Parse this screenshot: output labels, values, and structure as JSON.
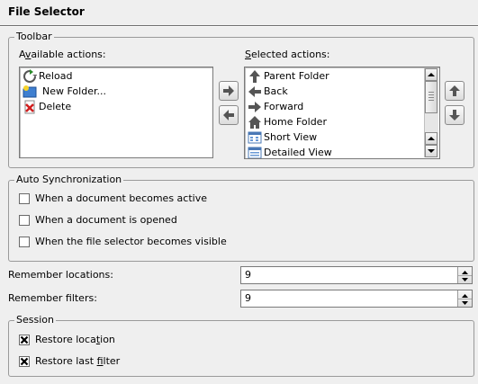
{
  "page_title": "File Selector",
  "toolbar": {
    "legend": "Toolbar",
    "available_label": "Available actions:",
    "selected_label": "Selected actions:",
    "available_items": [
      {
        "label": "Reload",
        "icon": "reload-icon"
      },
      {
        "label": "New Folder...",
        "icon": "new-folder-icon"
      },
      {
        "label": "Delete",
        "icon": "delete-icon"
      }
    ],
    "selected_items": [
      {
        "label": "Parent Folder",
        "icon": "up-arrow-icon"
      },
      {
        "label": "Back",
        "icon": "back-arrow-icon"
      },
      {
        "label": "Forward",
        "icon": "forward-arrow-icon"
      },
      {
        "label": "Home Folder",
        "icon": "home-icon"
      },
      {
        "label": "Short View",
        "icon": "short-view-icon"
      },
      {
        "label": "Detailed View",
        "icon": "detailed-view-icon"
      }
    ]
  },
  "auto_sync": {
    "legend": "Auto Synchronization",
    "options": [
      {
        "label": "When a document becomes active",
        "checked": false
      },
      {
        "label": "When a document is opened",
        "checked": false
      },
      {
        "label": "When the file selector becomes visible",
        "checked": false
      }
    ]
  },
  "remember_locations": {
    "label": "Remember locations:",
    "value": "9"
  },
  "remember_filters": {
    "label": "Remember filters:",
    "value": "9"
  },
  "session": {
    "legend": "Session",
    "options": [
      {
        "label": "Restore location",
        "checked": true
      },
      {
        "label": "Restore last filter",
        "checked": true
      }
    ]
  },
  "colors": {
    "background": "#efefef",
    "list_background": "#ffffff",
    "frame": "#9a9a9a"
  }
}
